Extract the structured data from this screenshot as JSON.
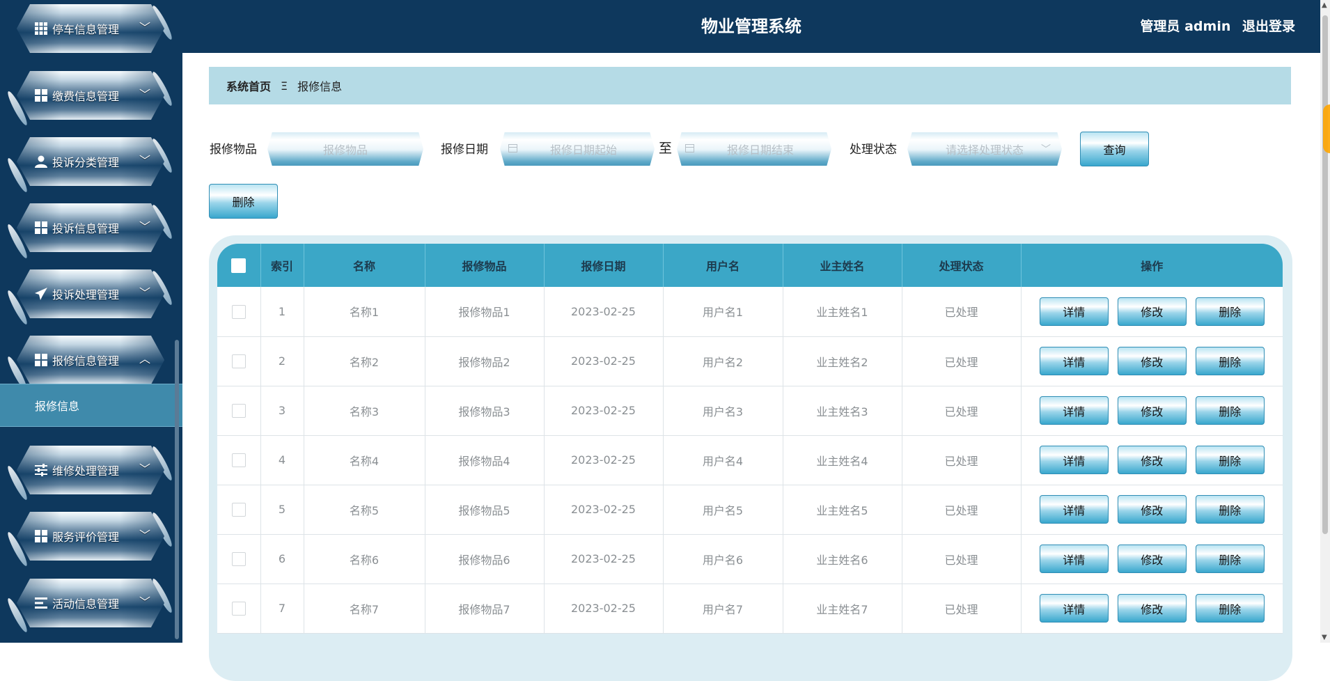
{
  "sidebar": {
    "menus": [
      {
        "label": "停车信息管理",
        "icon": "grid-icon",
        "expanded": false
      },
      {
        "label": "缴费信息管理",
        "icon": "grid-icon",
        "expanded": false
      },
      {
        "label": "投诉分类管理",
        "icon": "user-icon",
        "expanded": false
      },
      {
        "label": "投诉信息管理",
        "icon": "grid-icon",
        "expanded": false
      },
      {
        "label": "投诉处理管理",
        "icon": "paper-plane-icon",
        "expanded": false
      },
      {
        "label": "报修信息管理",
        "icon": "grid-icon",
        "expanded": true
      },
      {
        "label": "维修处理管理",
        "icon": "sliders-icon",
        "expanded": false
      },
      {
        "label": "服务评价管理",
        "icon": "grid-icon",
        "expanded": false
      },
      {
        "label": "活动信息管理",
        "icon": "list-icon",
        "expanded": false
      }
    ],
    "submenu_active": "报修信息"
  },
  "header": {
    "title": "物业管理系统",
    "user_label": "管理员 admin",
    "logout_label": "退出登录"
  },
  "breadcrumb": {
    "home": "系统首页",
    "separator": "Ξ",
    "current": "报修信息"
  },
  "search": {
    "item_label": "报修物品",
    "item_placeholder": "报修物品",
    "date_label": "报修日期",
    "date_start_placeholder": "报修日期起始",
    "date_to": "至",
    "date_end_placeholder": "报修日期结束",
    "status_label": "处理状态",
    "status_placeholder": "请选择处理状态",
    "query_button": "查询",
    "delete_button": "删除"
  },
  "table": {
    "columns": [
      "索引",
      "名称",
      "报修物品",
      "报修日期",
      "用户名",
      "业主姓名",
      "处理状态",
      "操作"
    ],
    "rows": [
      {
        "index": "1",
        "name": "名称1",
        "item": "报修物品1",
        "date": "2023-02-25",
        "user": "用户名1",
        "owner": "业主姓名1",
        "status": "已处理"
      },
      {
        "index": "2",
        "name": "名称2",
        "item": "报修物品2",
        "date": "2023-02-25",
        "user": "用户名2",
        "owner": "业主姓名2",
        "status": "已处理"
      },
      {
        "index": "3",
        "name": "名称3",
        "item": "报修物品3",
        "date": "2023-02-25",
        "user": "用户名3",
        "owner": "业主姓名3",
        "status": "已处理"
      },
      {
        "index": "4",
        "name": "名称4",
        "item": "报修物品4",
        "date": "2023-02-25",
        "user": "用户名4",
        "owner": "业主姓名4",
        "status": "已处理"
      },
      {
        "index": "5",
        "name": "名称5",
        "item": "报修物品5",
        "date": "2023-02-25",
        "user": "用户名5",
        "owner": "业主姓名5",
        "status": "已处理"
      },
      {
        "index": "6",
        "name": "名称6",
        "item": "报修物品6",
        "date": "2023-02-25",
        "user": "用户名6",
        "owner": "业主姓名6",
        "status": "已处理"
      },
      {
        "index": "7",
        "name": "名称7",
        "item": "报修物品7",
        "date": "2023-02-25",
        "user": "用户名7",
        "owner": "业主姓名7",
        "status": "已处理"
      }
    ],
    "actions": {
      "detail": "详情",
      "edit": "修改",
      "delete": "删除"
    }
  },
  "colors": {
    "navy": "#0e385d",
    "table_header": "#3ba7c7",
    "breadcrumb_bg": "#b5dbe6",
    "submenu_active_bg": "#3f8aab"
  }
}
